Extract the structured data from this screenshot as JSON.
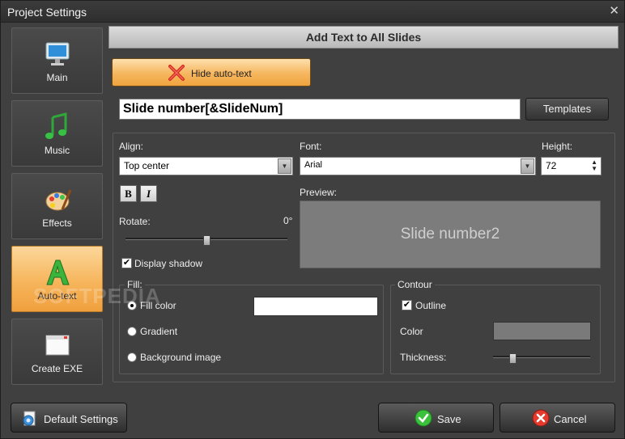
{
  "window": {
    "title": "Project Settings",
    "close_glyph": "✕"
  },
  "sidebar": {
    "items": [
      {
        "label": "Main",
        "icon": "monitor-icon",
        "active": false
      },
      {
        "label": "Music",
        "icon": "music-note-icon",
        "active": false
      },
      {
        "label": "Effects",
        "icon": "palette-icon",
        "active": false
      },
      {
        "label": "Auto-text",
        "icon": "letter-a-icon",
        "active": true
      },
      {
        "label": "Create EXE",
        "icon": "window-icon",
        "active": false
      }
    ]
  },
  "header": {
    "title": "Add Text to All Slides"
  },
  "hide_button": {
    "label": "Hide auto-text",
    "icon": "red-x-icon"
  },
  "text_field": {
    "value": "Slide number[&SlideNum]"
  },
  "templates_button": {
    "label": "Templates"
  },
  "align": {
    "label": "Align:",
    "value": "Top center"
  },
  "font": {
    "label": "Font:",
    "value": "Arial"
  },
  "height": {
    "label": "Height:",
    "value": "72"
  },
  "format": {
    "bold": "B",
    "italic": "I"
  },
  "rotate": {
    "label": "Rotate:",
    "value": "0°",
    "level": 0.5
  },
  "shadow": {
    "label": "Display shadow",
    "checked": true
  },
  "preview": {
    "label": "Preview:",
    "text": "Slide number2"
  },
  "fill": {
    "title": "Fill:",
    "options": [
      "Fill color",
      "Gradient",
      "Background image"
    ],
    "selected": "Fill color",
    "color": "#ffffff"
  },
  "contour": {
    "title": "Contour",
    "outline_label": "Outline",
    "outline_checked": true,
    "color_label": "Color",
    "color": "#7a7a7a",
    "thickness_label": "Thickness:",
    "thickness_level": 0.2
  },
  "footer": {
    "default_label": "Default Settings",
    "save_label": "Save",
    "cancel_label": "Cancel"
  },
  "watermark": "SOFTPEDIA",
  "colors": {
    "accent": "#f6b55c",
    "background": "#404040"
  }
}
